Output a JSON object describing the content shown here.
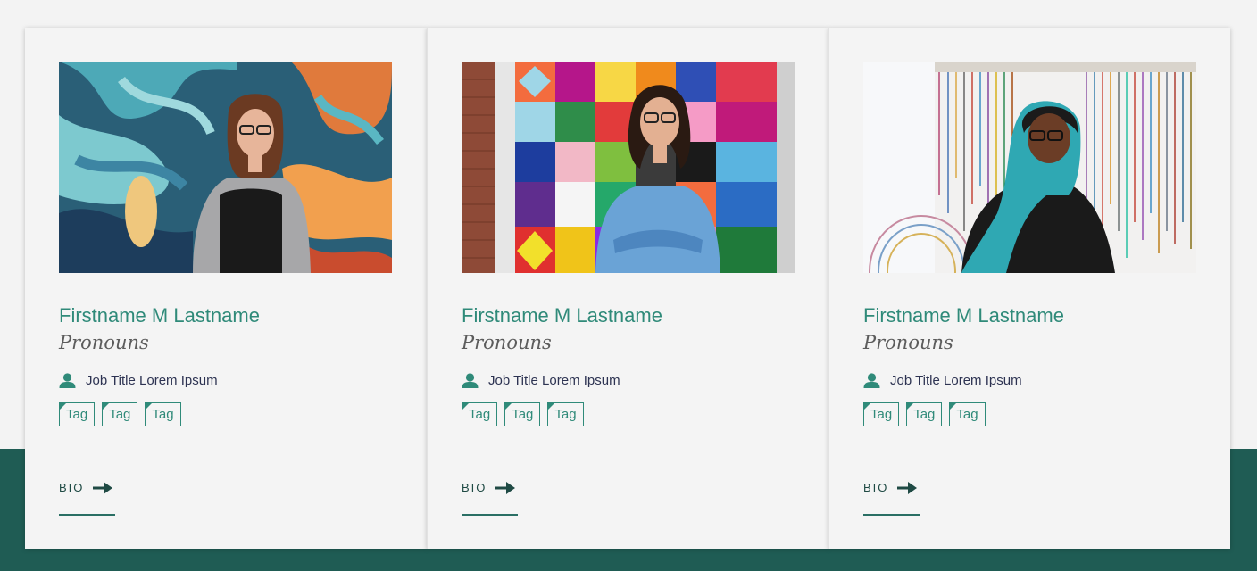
{
  "cards": [
    {
      "photo_icon": "person-photo-icon",
      "name": "Firstname M Lastname",
      "pronouns": "Pronouns",
      "job_title": "Job Title Lorem Ipsum",
      "tags": [
        "Tag",
        "Tag",
        "Tag"
      ],
      "bio_label": "BIO"
    },
    {
      "photo_icon": "person-photo-icon",
      "name": "Firstname M Lastname",
      "pronouns": "Pronouns",
      "job_title": "Job Title Lorem Ipsum",
      "tags": [
        "Tag",
        "Tag",
        "Tag"
      ],
      "bio_label": "BIO"
    },
    {
      "photo_icon": "person-photo-icon",
      "name": "Firstname M Lastname",
      "pronouns": "Pronouns",
      "job_title": "Job Title Lorem Ipsum",
      "tags": [
        "Tag",
        "Tag",
        "Tag"
      ],
      "bio_label": "BIO"
    }
  ],
  "colors": {
    "accent": "#2f8a79",
    "band": "#1f5c54",
    "text_dark": "#2d3352"
  }
}
